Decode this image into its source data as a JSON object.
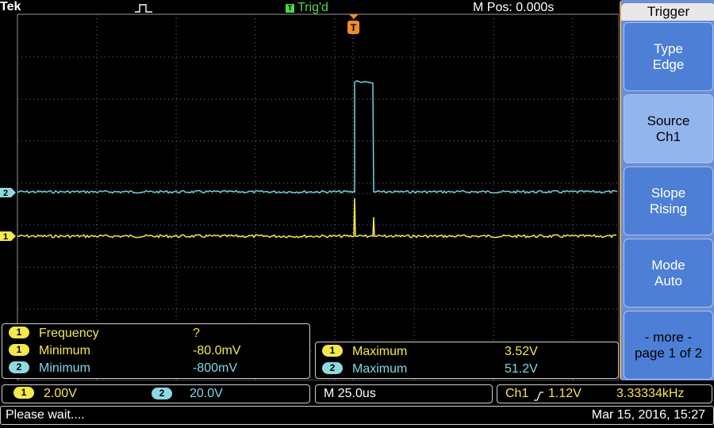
{
  "header": {
    "brand": "Tek",
    "trigger_state_icon_letter": "T",
    "trigger_state": "Trig'd",
    "horizontal_position": "M Pos: 0.000s",
    "acquire_icon": "pulse-icon"
  },
  "graticule": {
    "channel2_marker": "2",
    "channel1_marker": "1",
    "trigger_position_marker": "T",
    "trace_colors": {
      "ch1": "#f4e84a",
      "ch2": "#6fd3df"
    }
  },
  "measurements_left": [
    {
      "channel": "1",
      "name": "Frequency",
      "value": "?"
    },
    {
      "channel": "1",
      "name": "Minimum",
      "value": "-80.0mV"
    },
    {
      "channel": "2",
      "name": "Minimum",
      "value": "-800mV"
    }
  ],
  "measurements_right": [
    {
      "channel": "1",
      "name": "Maximum",
      "value": "3.52V"
    },
    {
      "channel": "2",
      "name": "Maximum",
      "value": "51.2V"
    }
  ],
  "side_menu": {
    "title": "Trigger",
    "buttons": [
      {
        "line1": "Type",
        "line2": "Edge"
      },
      {
        "line1": "Source",
        "line2": "Ch1"
      },
      {
        "line1": "Slope",
        "line2": "Rising"
      },
      {
        "line1": "Mode",
        "line2": "Auto"
      },
      {
        "line1": "- more -",
        "line2": "page 1 of 2"
      }
    ]
  },
  "bottom": {
    "ch1_label": "1",
    "ch1_scale": "2.00V",
    "ch2_label": "2",
    "ch2_scale": "20.0V",
    "timebase": "M 25.0us",
    "trigger_source": "Ch1",
    "trigger_slope_icon": "rising-edge-icon",
    "trigger_level": "1.12V",
    "trigger_frequency": "3.33334kHz"
  },
  "status": {
    "message": "Please wait....",
    "datetime": "Mar 15, 2016, 15:27"
  }
}
